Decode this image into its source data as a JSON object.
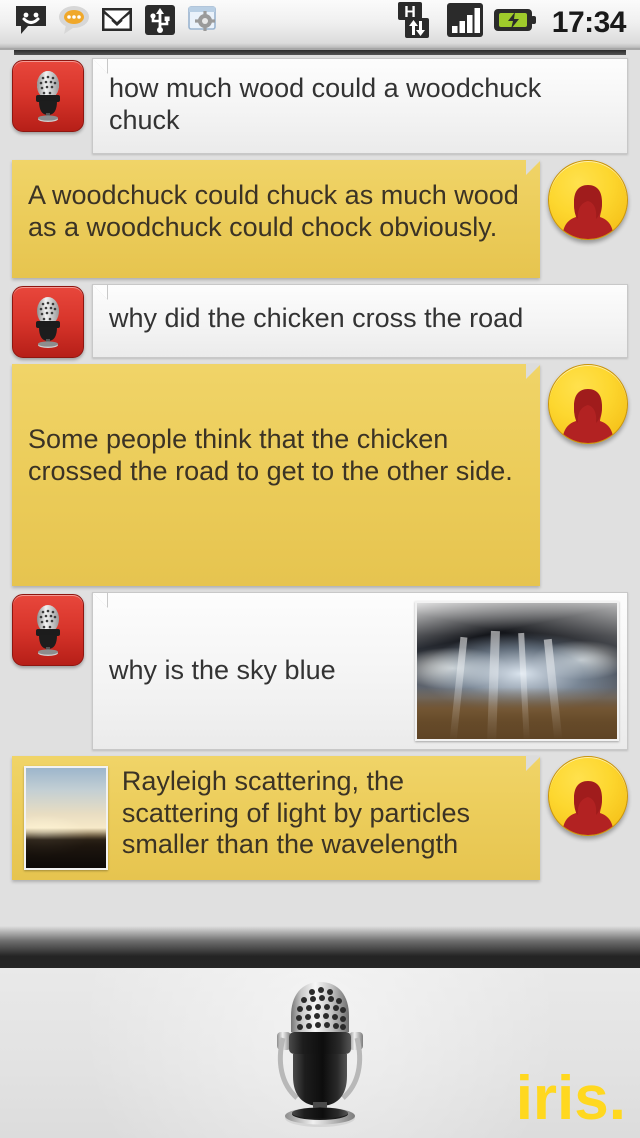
{
  "app": {
    "name": "iris.",
    "logo_color": "#ffd81f"
  },
  "statusbar": {
    "time": "17:34",
    "left_icons": [
      {
        "name": "sms-messaging-icon",
        "label": "Messaging"
      },
      {
        "name": "chat-bubble-icon",
        "label": "Chat"
      },
      {
        "name": "gmail-icon",
        "label": "Gmail"
      },
      {
        "name": "usb-icon",
        "label": "USB connected"
      },
      {
        "name": "settings-gear-icon",
        "label": "Settings"
      }
    ],
    "right_icons": [
      {
        "name": "hspa-data-icon",
        "label": "H"
      },
      {
        "name": "signal-strength-icon",
        "label": "Signal"
      },
      {
        "name": "battery-charging-icon",
        "label": "Charging"
      }
    ]
  },
  "conversation": {
    "messages": [
      {
        "id": "m1",
        "sender": "user",
        "avatar": "microphone-avatar",
        "bubble_style": "white",
        "text": "how much wood could a woodchuck chuck",
        "image": null
      },
      {
        "id": "m2",
        "sender": "bot",
        "avatar": "person-avatar",
        "bubble_style": "yellow",
        "text": "A woodchuck could chuck as much wood as a woodchuck could chock obviously.",
        "image": null
      },
      {
        "id": "m3",
        "sender": "user",
        "avatar": "microphone-avatar",
        "bubble_style": "white",
        "text": "why did the chicken cross the road",
        "image": null
      },
      {
        "id": "m4",
        "sender": "bot",
        "avatar": "person-avatar",
        "bubble_style": "yellow",
        "text": "Some people think that the chicken crossed the road to get to the other side.",
        "image": null
      },
      {
        "id": "m5",
        "sender": "user",
        "avatar": "microphone-avatar",
        "bubble_style": "white",
        "text": "why is the sky blue",
        "image": "sun-rays-through-clouds-photo"
      },
      {
        "id": "m6",
        "sender": "bot",
        "avatar": "person-avatar",
        "bubble_style": "yellow",
        "text": "Rayleigh scattering, the scattering of light by particles smaller than the wavelength",
        "image": "sunset-beach-photo",
        "truncated": true
      }
    ]
  },
  "footer": {
    "mic_button_label": "Tap to speak",
    "logo_text": "iris."
  }
}
